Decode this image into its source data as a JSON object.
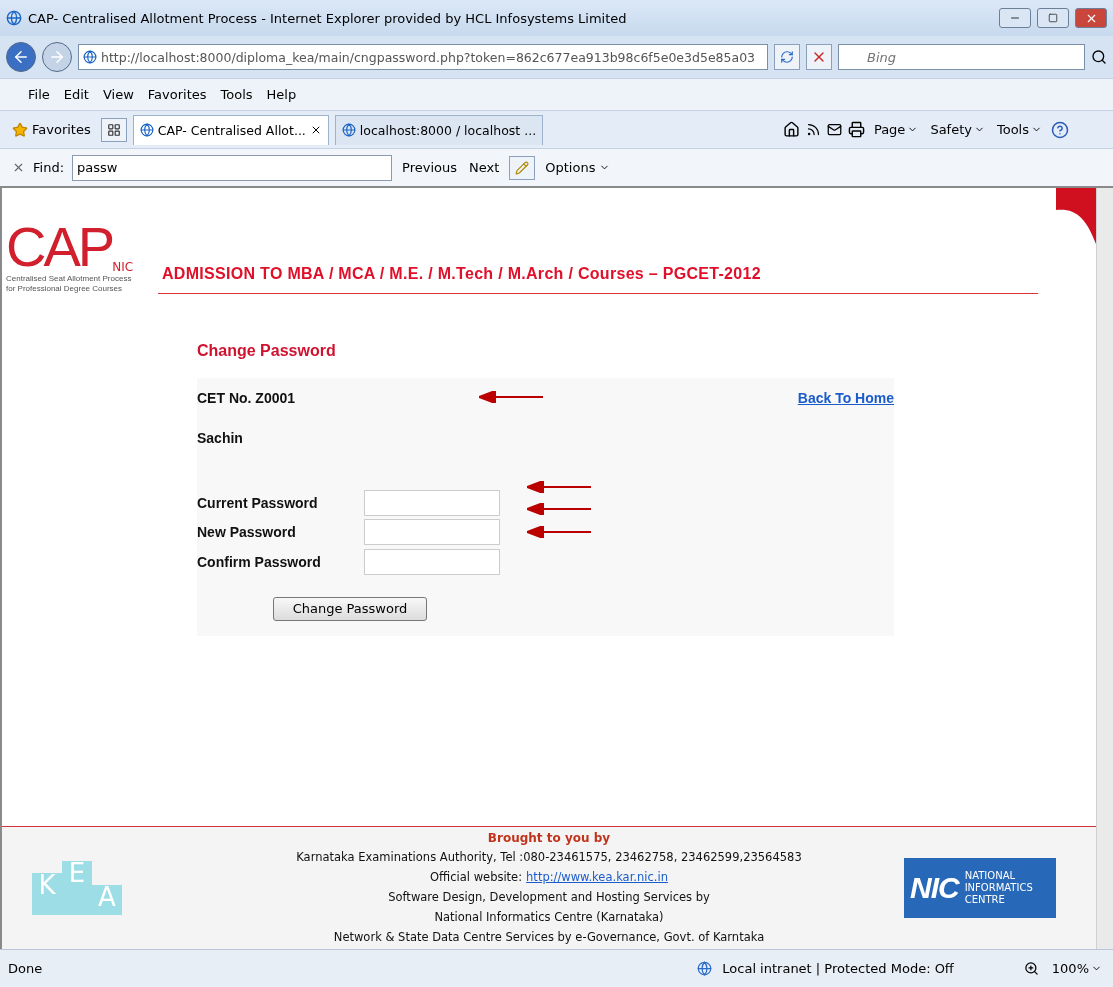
{
  "window": {
    "title": "CAP- Centralised Allotment Process - Internet Explorer provided by HCL Infosystems Limited"
  },
  "address_bar": {
    "url": "http://localhost:8000/diploma_kea/main/cngpassword.php?token=862c677ea913b98c6f5e0e3d5e85a03",
    "search_placeholder": "Bing"
  },
  "menu": [
    "File",
    "Edit",
    "View",
    "Favorites",
    "Tools",
    "Help"
  ],
  "favorites_label": "Favorites",
  "tabs": [
    {
      "label": "CAP- Centralised Allot...",
      "selected": true
    },
    {
      "label": "localhost:8000 / localhost ...",
      "selected": false
    }
  ],
  "commands": [
    "Page",
    "Safety",
    "Tools"
  ],
  "find_bar": {
    "label": "Find:",
    "value": "passw",
    "buttons": [
      "Previous",
      "Next"
    ],
    "options": "Options"
  },
  "header": {
    "logo_text": "CAP",
    "logo_sub": "NIC",
    "tagline": [
      "Centralised Seat Allotment Process",
      "for Professional Degree Courses"
    ],
    "title": "ADMISSION TO MBA / MCA / M.E. / M.Tech / M.Arch / Courses – PGCET-2012"
  },
  "form": {
    "heading": "Change Password",
    "cet": "CET No. Z0001",
    "back_link": "Back To Home",
    "name": "Sachin",
    "fields": [
      {
        "label": "Current Password"
      },
      {
        "label": "New Password"
      },
      {
        "label": "Confirm Password"
      }
    ],
    "submit": "Change Password"
  },
  "footer": {
    "heading": "Brought to you by",
    "lines": [
      "Karnataka Examinations Authority, Tel :080-23461575, 23462758, 23462599,23564583"
    ],
    "website_label": "Official website:",
    "website_link": "http://www.kea.kar.nic.in",
    "credits": [
      "Software Design, Development and Hosting Services by",
      "National Informatics Centre (Karnataka)",
      "Network & State Data Centre Services by e-Governance, Govt. of Karntaka"
    ],
    "kea_letters": [
      "K",
      "E",
      "A"
    ],
    "nic_logo": "NIC",
    "nic_name": [
      "NATIONAL",
      "INFORMATICS",
      "CENTRE"
    ]
  },
  "status_bar": {
    "text": "Done",
    "zone": "Local intranet | Protected Mode: Off",
    "zoom": "100%"
  }
}
